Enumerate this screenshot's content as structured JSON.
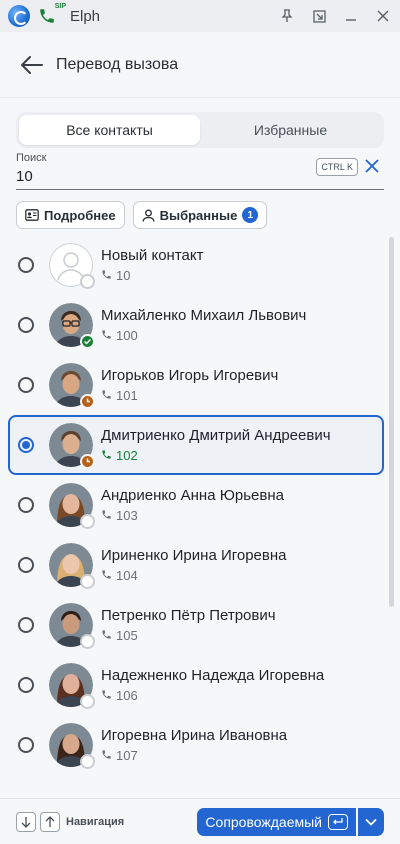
{
  "window": {
    "app_name": "Elph",
    "sip_badge": "SIP",
    "controls": {
      "pin": "pin-icon",
      "restore": "restore-icon",
      "minimize": "minimize-icon",
      "close": "close-icon"
    }
  },
  "header": {
    "title": "Перевод вызова"
  },
  "tabs": [
    {
      "label": "Все контакты",
      "active": true
    },
    {
      "label": "Избранные",
      "active": false
    }
  ],
  "search": {
    "label": "Поиск",
    "value": "10",
    "shortcut": "CTRL K"
  },
  "chips": {
    "details_label": "Подробнее",
    "selected_label": "Выбранные",
    "selected_count": "1"
  },
  "contacts": [
    {
      "name": "Новый контакт",
      "ext": "10",
      "status": "offline",
      "selected": false,
      "avatar": "placeholder",
      "skin": "#d0d3d7",
      "hair": "#c9cdd2"
    },
    {
      "name": "Михайленко Михаил Львович",
      "ext": "100",
      "status": "online",
      "selected": false,
      "avatar": "man-glasses",
      "skin": "#d9a884",
      "hair": "#3a2a20"
    },
    {
      "name": "Игорьков Игорь Игоревич",
      "ext": "101",
      "status": "away",
      "selected": false,
      "avatar": "man",
      "skin": "#d7a786",
      "hair": "#6a4a30"
    },
    {
      "name": "Дмитриенко Дмитрий Андреевич",
      "ext": "102",
      "status": "away",
      "selected": true,
      "avatar": "man",
      "skin": "#dcaf90",
      "hair": "#5a4030"
    },
    {
      "name": "Андриенко Анна Юрьевна",
      "ext": "103",
      "status": "offline",
      "selected": false,
      "avatar": "woman",
      "skin": "#e3b79c",
      "hair": "#7a4a28"
    },
    {
      "name": "Ириненко Ирина Игоревна",
      "ext": "104",
      "status": "offline",
      "selected": false,
      "avatar": "woman",
      "skin": "#ecc7ae",
      "hair": "#d9b070"
    },
    {
      "name": "Петренко Пётр Петрович",
      "ext": "105",
      "status": "offline",
      "selected": false,
      "avatar": "man",
      "skin": "#c99a7c",
      "hair": "#2a1e18"
    },
    {
      "name": "Надежненко Надежда Игоревна",
      "ext": "106",
      "status": "offline",
      "selected": false,
      "avatar": "woman",
      "skin": "#e0b09a",
      "hair": "#5a3020"
    },
    {
      "name": "Игоревна Ирина Ивановна",
      "ext": "107",
      "status": "offline",
      "selected": false,
      "avatar": "woman",
      "skin": "#d8a88c",
      "hair": "#3a2418"
    }
  ],
  "footer": {
    "nav_label": "Навигация",
    "action_label": "Сопровождаемый"
  },
  "colors": {
    "accent": "#2366d1",
    "online": "#1a7f37",
    "away": "#b7621b"
  }
}
